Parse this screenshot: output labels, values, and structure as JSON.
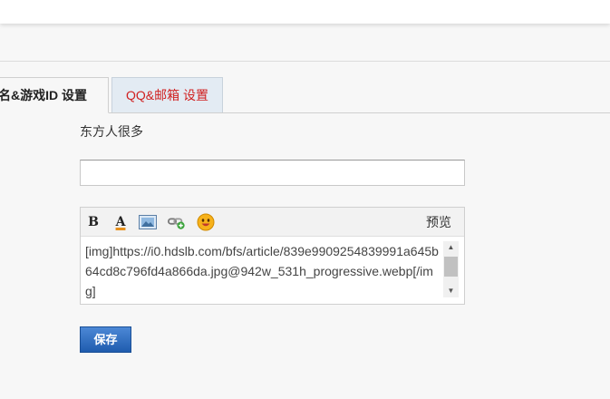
{
  "tabs": [
    {
      "label": "名&游戏ID 设置",
      "active": true
    },
    {
      "label": "QQ&邮箱 设置",
      "active": false
    }
  ],
  "form": {
    "description": "东方人很多",
    "text_input_value": ""
  },
  "editor": {
    "toolbar": {
      "bold_label": "B",
      "color_label": "A",
      "preview_label": "预览",
      "icons": [
        "bold-icon",
        "font-color-icon",
        "image-icon",
        "link-icon",
        "emoji-icon"
      ]
    },
    "content": "[img]https://i0.hdslb.com/bfs/article/839e9909254839991a645b64cd8c796fd4a866da.jpg@942w_531h_progressive.webp[/img]"
  },
  "actions": {
    "save_label": "保存"
  },
  "colors": {
    "tab_inactive_text": "#d02020",
    "tab_inactive_bg": "#e3ebf3",
    "save_button": "#2f6fc4"
  }
}
